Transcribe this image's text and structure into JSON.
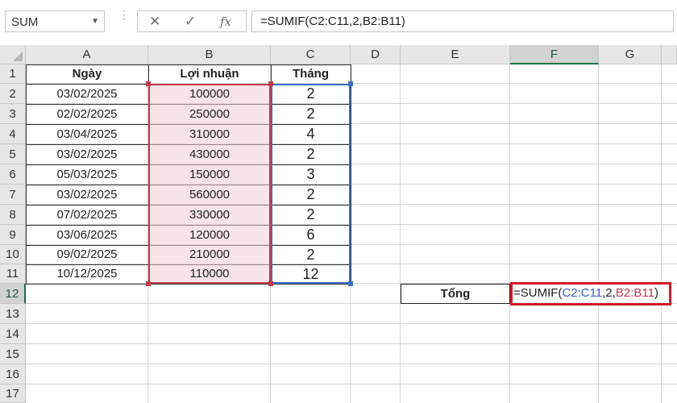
{
  "name_box": {
    "value": "SUM"
  },
  "formula_bar": {
    "cancel_glyph": "✕",
    "enter_glyph": "✓",
    "fx_label": "fx",
    "formula": "=SUMIF(C2:C11,2,B2:B11)"
  },
  "columns": [
    "A",
    "B",
    "C",
    "D",
    "E",
    "F",
    "G"
  ],
  "rows": [
    "1",
    "2",
    "3",
    "4",
    "5",
    "6",
    "7",
    "8",
    "9",
    "10",
    "11",
    "12",
    "13",
    "14",
    "15",
    "16",
    "17"
  ],
  "headers": {
    "a": "Ngày",
    "b": "Lợi nhuận",
    "c": "Tháng"
  },
  "data_rows": [
    {
      "date": "03/02/2025",
      "profit": "100000",
      "month": "2"
    },
    {
      "date": "02/02/2025",
      "profit": "250000",
      "month": "2"
    },
    {
      "date": "03/04/2025",
      "profit": "310000",
      "month": "4"
    },
    {
      "date": "03/02/2025",
      "profit": "430000",
      "month": "2"
    },
    {
      "date": "05/03/2025",
      "profit": "150000",
      "month": "3"
    },
    {
      "date": "03/02/2025",
      "profit": "560000",
      "month": "2"
    },
    {
      "date": "07/02/2025",
      "profit": "330000",
      "month": "2"
    },
    {
      "date": "03/06/2025",
      "profit": "120000",
      "month": "6"
    },
    {
      "date": "09/02/2025",
      "profit": "210000",
      "month": "2"
    },
    {
      "date": "10/12/2025",
      "profit": "110000",
      "month": "12"
    }
  ],
  "total": {
    "label": "Tổng",
    "formula_parts": {
      "prefix": "=SUMIF(",
      "criteria_range": "C2:C11",
      "criteria": ",2,",
      "sum_range": "B2:B11",
      "suffix": ")"
    }
  },
  "colors": {
    "selection_green": "#217346",
    "range_b_border": "#c0394b",
    "range_b_fill": "#f4d0d6",
    "range_c_border": "#3b6fc5",
    "edit_cell_highlight": "#d11a2a"
  }
}
